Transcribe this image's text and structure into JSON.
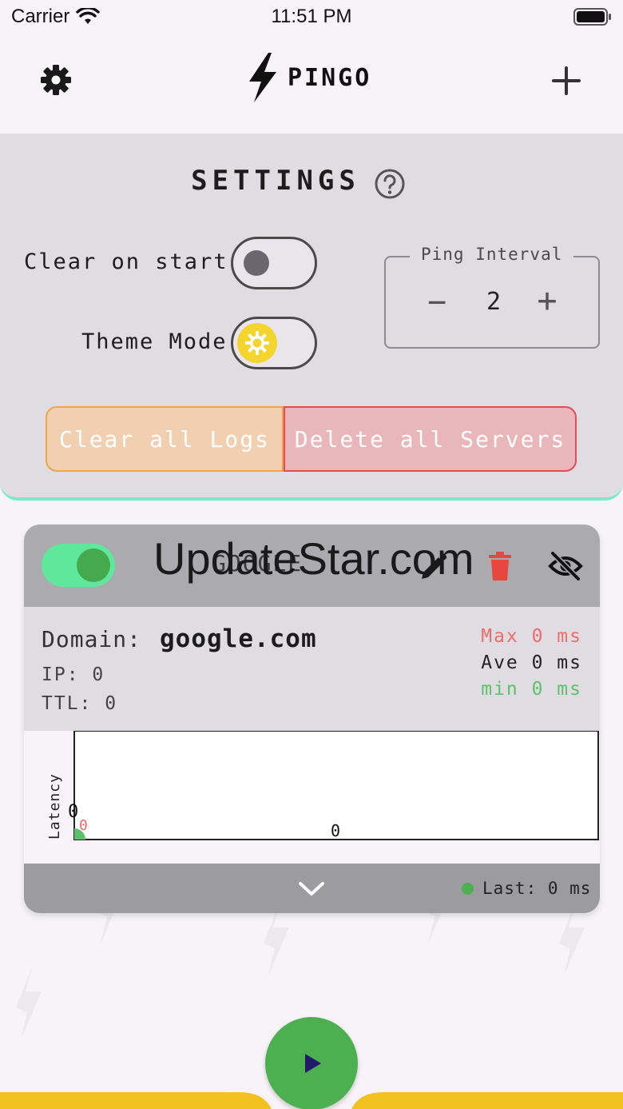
{
  "status_bar": {
    "carrier": "Carrier",
    "time": "11:51 PM"
  },
  "app_bar": {
    "title": "PINGO"
  },
  "settings": {
    "title": "SETTINGS",
    "clear_on_start_label": "Clear on start",
    "theme_mode_label": "Theme Mode",
    "clear_on_start": false,
    "ping_interval_label": "Ping Interval",
    "ping_interval_value": "2",
    "minus_label": "−",
    "plus_label": "+",
    "clear_logs_label": "Clear all Logs",
    "delete_servers_label": "Delete all Servers"
  },
  "server": {
    "name": "GOOGLE",
    "enabled": true,
    "domain_label": "Domain:",
    "domain": "google.com",
    "ip_text": "IP: 0",
    "ttl_text": "TTL: 0",
    "max_text": "Max 0 ms",
    "ave_text": "Ave 0 ms",
    "min_text": "min 0 ms",
    "last_text": "Last: 0 ms"
  },
  "chart_data": {
    "type": "line",
    "ylabel": "Latency",
    "x": [
      0
    ],
    "values": [
      0
    ],
    "y_tick_labels": [
      "0"
    ],
    "x_tick_labels": [
      "0"
    ],
    "point_label": "0"
  },
  "watermark": "UpdateStar.com",
  "colors": {
    "accent_green": "#4caf50",
    "toggle_on": "#5fe79b",
    "clear_border": "#f0a545",
    "delete_border": "#e8495a",
    "max_red": "#ef6c6c",
    "min_green": "#5cc16a",
    "panel_border_teal": "#7ee9c9",
    "bottom_band_yellow": "#f3c11d"
  }
}
